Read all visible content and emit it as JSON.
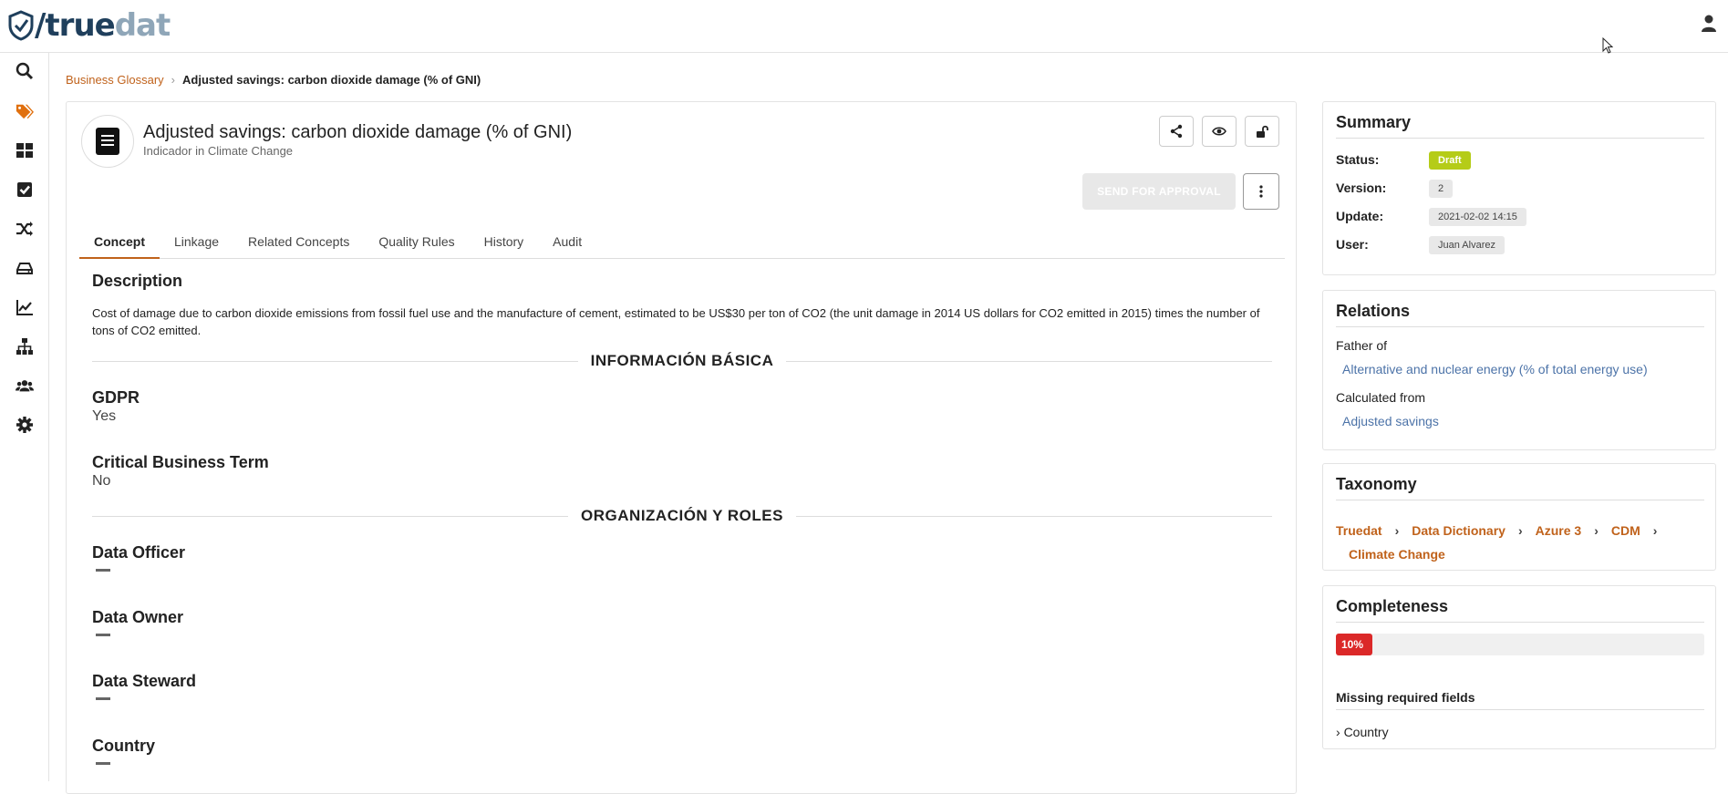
{
  "app": {
    "logo_left": "/",
    "logo_true": "true",
    "logo_dat": "dat"
  },
  "colors": {
    "accent": "#c0621b",
    "draft": "#b5cc18",
    "completeness": "#db2828",
    "link": "#4c73a8"
  },
  "sidebar": {
    "items": [
      {
        "icon": "search-icon"
      },
      {
        "icon": "tags-icon",
        "active": true
      },
      {
        "icon": "dashboard-icon"
      },
      {
        "icon": "check-square-icon"
      },
      {
        "icon": "shuffle-icon"
      },
      {
        "icon": "hdd-icon"
      },
      {
        "icon": "line-chart-icon"
      },
      {
        "icon": "sitemap-icon"
      },
      {
        "icon": "users-icon"
      },
      {
        "icon": "settings-icon"
      }
    ]
  },
  "breadcrumb": {
    "root": "Business Glossary",
    "current": "Adjusted savings: carbon dioxide damage (% of GNI)"
  },
  "concept": {
    "title": "Adjusted savings: carbon dioxide damage (% of GNI)",
    "subtitle": "Indicador in Climate Change",
    "send_for_approval": "SEND FOR APPROVAL"
  },
  "tabs": [
    "Concept",
    "Linkage",
    "Related Concepts",
    "Quality Rules",
    "History",
    "Audit"
  ],
  "description": {
    "title": "Description",
    "text": "Cost of damage due to carbon dioxide emissions from fossil fuel use and the manufacture of cement, estimated to be US$30 per ton of CO2 (the unit damage in 2014 US dollars for CO2 emitted in 2015) times the number of tons of CO2 emitted."
  },
  "sections": {
    "basic": "INFORMACIÓN BÁSICA",
    "org": "ORGANIZACIÓN Y ROLES"
  },
  "fields": {
    "gdpr_label": "GDPR",
    "gdpr_value": "Yes",
    "cbt_label": "Critical Business Term",
    "cbt_value": "No",
    "officer_label": "Data Officer",
    "owner_label": "Data Owner",
    "steward_label": "Data Steward",
    "country_label": "Country"
  },
  "summary": {
    "title": "Summary",
    "status_label": "Status:",
    "status_value": "Draft",
    "version_label": "Version:",
    "version_value": "2",
    "update_label": "Update:",
    "update_value": "2021-02-02 14:15",
    "user_label": "User:",
    "user_value": "Juan Alvarez"
  },
  "relations": {
    "title": "Relations",
    "father_label": "Father of",
    "father_link": "Alternative and nuclear energy (% of total energy use)",
    "calc_label": "Calculated from",
    "calc_link": "Adjusted savings"
  },
  "taxonomy": {
    "title": "Taxonomy",
    "path": [
      "Truedat",
      "Data Dictionary",
      "Azure 3",
      "CDM",
      "Climate Change"
    ]
  },
  "completeness": {
    "title": "Completeness",
    "percent_label": "10%",
    "percent": 10,
    "missing_title": "Missing required fields",
    "missing_items": [
      "Country"
    ]
  }
}
